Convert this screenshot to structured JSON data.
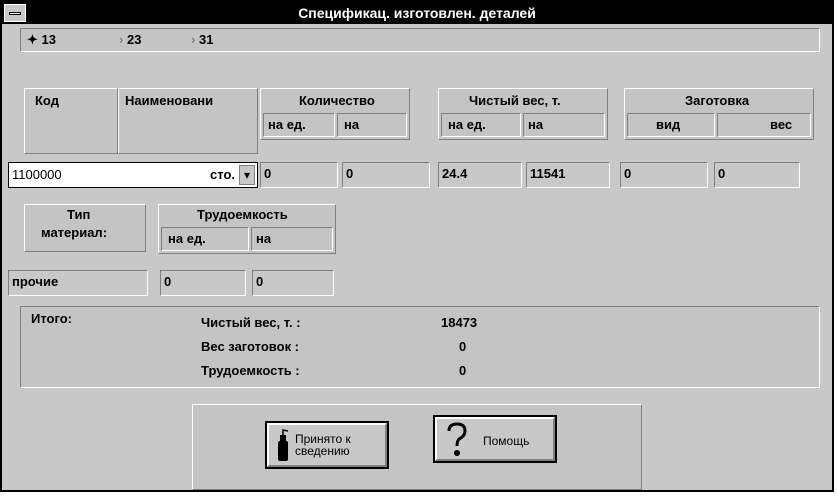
{
  "window": {
    "title": "Спецификац. изготовлен. деталей"
  },
  "tabs": [
    {
      "label": "13",
      "selected": true
    },
    {
      "label": "23",
      "selected": false
    },
    {
      "label": "31",
      "selected": false
    }
  ],
  "headers": {
    "kod": "Код",
    "name": "Наименовани",
    "quantity": "Количество",
    "quantity_per_unit": "на ед.",
    "quantity_total": "на",
    "net_weight": "Чистый вес, т.",
    "net_weight_per_unit": "на ед.",
    "net_weight_total": "на",
    "blank": "Заготовка",
    "blank_type": "вид",
    "blank_weight": "вес",
    "material_type_line1": "Тип",
    "material_type_line2": "материал:",
    "labor": "Трудоемкость",
    "labor_per_unit": "на ед.",
    "labor_total": "на"
  },
  "row": {
    "code_value": "1100000",
    "code_tail": "сто.",
    "dropdown_icon": "arrow-down-icon",
    "qty_per_unit": "0",
    "qty_total": "0",
    "weight_per_unit": "24.4",
    "weight_total": "11541",
    "blank_type": "0",
    "blank_weight": "0",
    "material": "прочие",
    "labor_per_unit": "0",
    "labor_total": "0"
  },
  "totals": {
    "label": "Итого:",
    "net_weight_label": "Чистый вес, т. :",
    "net_weight_value": "18473",
    "blank_weight_label": "Вес заготовок  :",
    "blank_weight_value": "0",
    "labor_label": "Трудоемкость  :",
    "labor_value": "0"
  },
  "buttons": {
    "accept_line1": "Принято к",
    "accept_line2": "сведению",
    "help": "Помощь"
  }
}
